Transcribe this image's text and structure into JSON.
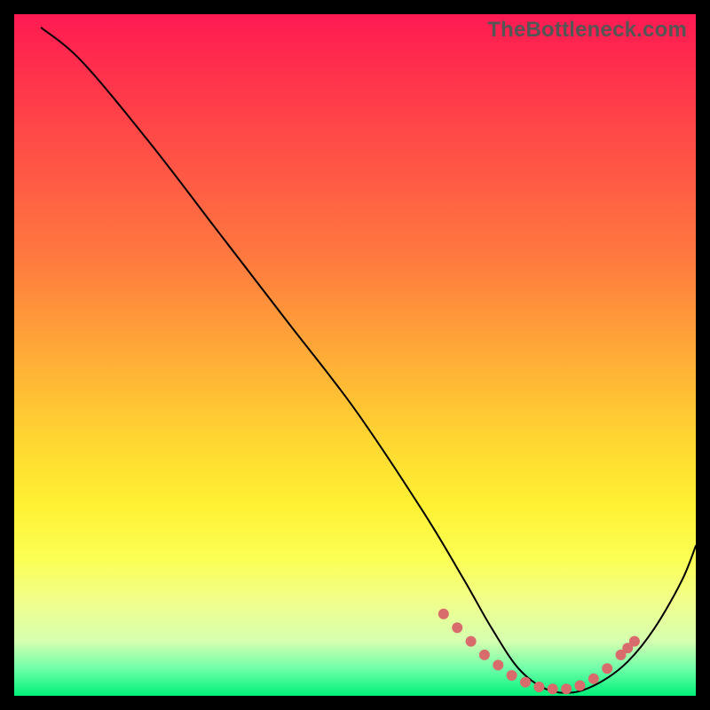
{
  "watermark": "TheBottleneck.com",
  "chart_data": {
    "type": "line",
    "title": "",
    "xlabel": "",
    "ylabel": "",
    "xrange": [
      0,
      100
    ],
    "yrange": [
      0,
      100
    ],
    "note": "Values are approximate normalized positions read from the rendered curve (0=bottom/left, 100=top/right). The curve represents a bottleneck/fit metric that descends from top-left, reaches a minimum near x≈76, and rises toward the right edge. Pink markers cluster around the minimum.",
    "series": [
      {
        "name": "curve",
        "x": [
          4,
          10,
          20,
          30,
          40,
          50,
          60,
          66,
          70,
          74,
          78,
          82,
          86,
          90,
          94,
          98,
          100
        ],
        "y": [
          98,
          93,
          81,
          68,
          55,
          42,
          27,
          17,
          10,
          4,
          1,
          0.5,
          2,
          5,
          10,
          17,
          22
        ]
      }
    ],
    "markers": {
      "name": "highlight-range",
      "x": [
        63,
        65,
        67,
        69,
        71,
        73,
        75,
        77,
        79,
        81,
        83,
        85,
        87,
        89,
        90,
        91
      ],
      "y": [
        12,
        10,
        8,
        6,
        4.5,
        3,
        2,
        1.3,
        1,
        1,
        1.5,
        2.5,
        4,
        6,
        7,
        8
      ]
    },
    "colors": {
      "curve": "#000000",
      "markers": "#d86b6b",
      "gradient_top": "#ff1a52",
      "gradient_mid": "#ffd832",
      "gradient_bottom": "#00f07a",
      "frame": "#000000"
    }
  }
}
